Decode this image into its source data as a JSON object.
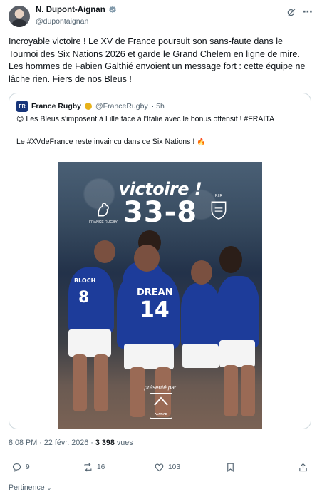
{
  "author": {
    "name": "N. Dupont-Aignan",
    "handle": "@dupontaignan"
  },
  "tweet": {
    "text": "Incroyable victoire ! Le XV de France poursuit son sans-faute dans le Tournoi des Six Nations 2026 et garde le Grand Chelem en ligne de mire. Les hommes de Fabien Galthié envoient un message fort : cette équipe ne lâche rien. Fiers de nos Bleus !"
  },
  "quoted": {
    "name": "France Rugby",
    "handle": "@FranceRugby",
    "time": "· 5h",
    "line1": "Les Bleus s'imposent à Lille face à l'Italie avec le bonus offensif ! #FRAITA",
    "line2": "Le #XVdeFrance reste invaincu dans ce Six Nations !",
    "image": {
      "headline": "victoire !",
      "score": "33-8",
      "left_crest_label": "FRANCE RUGBY",
      "right_crest_label": "F.I.R",
      "jersey_name": "DREAN",
      "jersey_number": "14",
      "jersey_number_2": "8",
      "jersey_name_2": "BLOCH",
      "presented_by": "présenté par",
      "sponsor": "ALTRAD"
    }
  },
  "timestamp": {
    "time": "8:08 PM · 22 févr. 2026 · ",
    "views_count": "3 398",
    "views_label": " vues"
  },
  "actions": {
    "replies": "9",
    "reposts": "16",
    "likes": "103"
  },
  "footer": {
    "pertinence": "Pertinence"
  },
  "colors": {
    "text": "#0f1419",
    "muted": "#536471",
    "border": "#cfd9de",
    "verified": "#829aab",
    "jersey": "#1d3c9a"
  }
}
